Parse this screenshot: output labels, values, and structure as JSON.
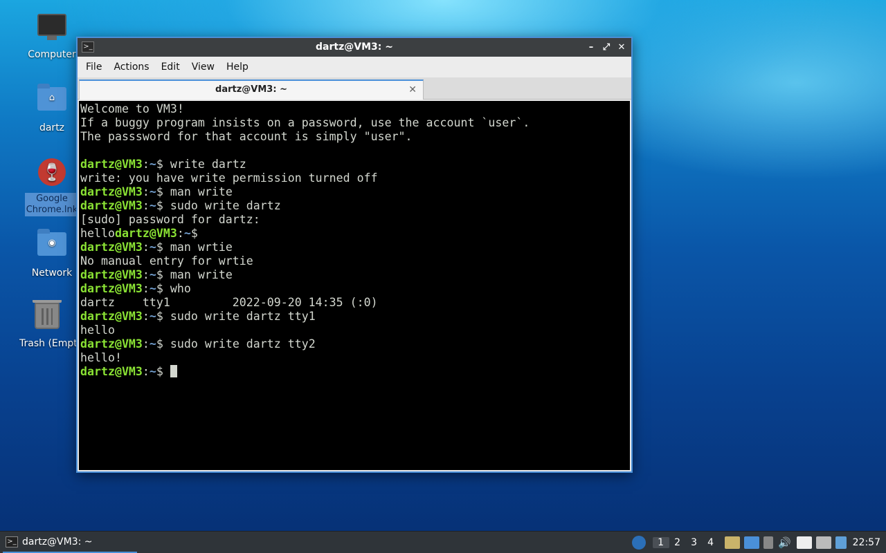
{
  "desktop": {
    "icons": [
      {
        "label": "Computer",
        "icon": "computer-icon"
      },
      {
        "label": "dartz",
        "icon": "home-folder-icon"
      },
      {
        "label": "Google\nChrome.lnk",
        "icon": "chrome-icon"
      },
      {
        "label": "Network",
        "icon": "network-folder-icon"
      },
      {
        "label": "Trash (Empty)",
        "icon": "trash-icon"
      }
    ]
  },
  "window": {
    "title": "dartz@VM3: ~",
    "controls": {
      "minimize": "–",
      "maximize": "⤢",
      "close": "✕"
    },
    "menu": [
      "File",
      "Actions",
      "Edit",
      "View",
      "Help"
    ],
    "tab": {
      "title": "dartz@VM3: ~",
      "close": "✕"
    }
  },
  "terminal": {
    "prompt_user": "dartz@VM3",
    "prompt_path": "~",
    "lines": [
      {
        "text": "Welcome to VM3!"
      },
      {
        "text": "If a buggy program insists on a password, use the account `user`."
      },
      {
        "text": "The passsword for that account is simply \"user\"."
      },
      {
        "text": ""
      },
      {
        "prompt": true,
        "cmd": "write dartz"
      },
      {
        "text": "write: you have write permission turned off"
      },
      {
        "prompt": true,
        "cmd": "man write"
      },
      {
        "prompt": true,
        "cmd": "sudo write dartz"
      },
      {
        "text": "[sudo] password for dartz:"
      },
      {
        "prefix": "hello",
        "prompt": true,
        "cmd": ""
      },
      {
        "prompt": true,
        "cmd": "man wrtie"
      },
      {
        "text": "No manual entry for wrtie"
      },
      {
        "prompt": true,
        "cmd": "man write"
      },
      {
        "prompt": true,
        "cmd": "who"
      },
      {
        "text": "dartz    tty1         2022-09-20 14:35 (:0)"
      },
      {
        "prompt": true,
        "cmd": "sudo write dartz tty1"
      },
      {
        "text": "hello"
      },
      {
        "prompt": true,
        "cmd": "sudo write dartz tty2"
      },
      {
        "text": "hello!"
      },
      {
        "prompt": true,
        "cmd": "",
        "cursor": true
      }
    ]
  },
  "taskbar": {
    "task_label": "dartz@VM3: ~",
    "workspaces": [
      "1",
      "2",
      "3",
      "4"
    ],
    "active_workspace": "1",
    "clock": "22:57"
  }
}
